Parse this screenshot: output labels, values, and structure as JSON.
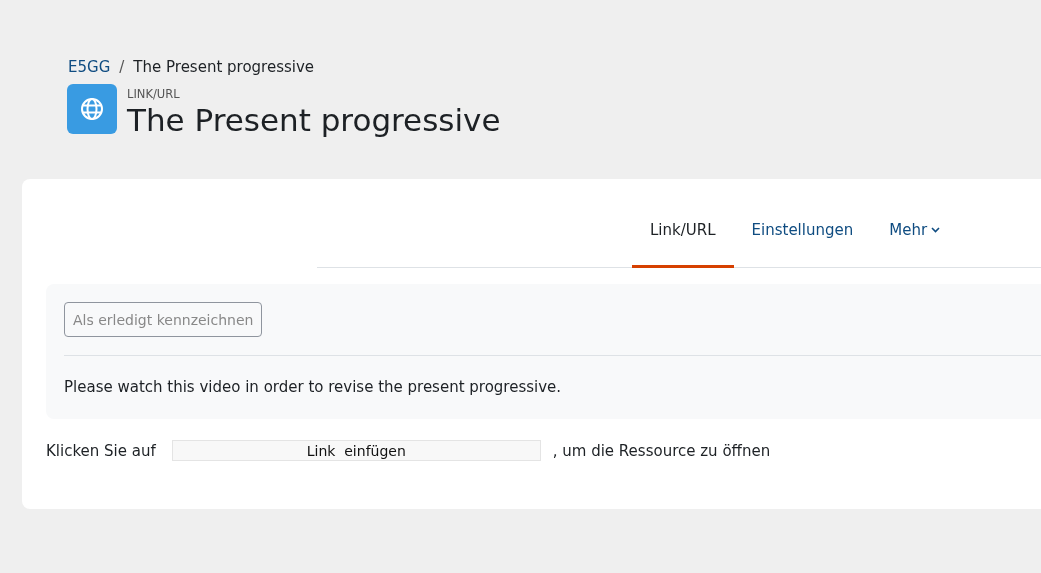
{
  "breadcrumb": [
    {
      "label": "E5GG",
      "kind": "link"
    },
    {
      "label": "/",
      "kind": "separator"
    },
    {
      "label": "The Present progressive",
      "kind": "current"
    }
  ],
  "header": {
    "type_label": "LINK/URL",
    "title": "The Present progressive"
  },
  "tabs": [
    {
      "label": "Link/URL",
      "selected": true,
      "dropdown": false
    },
    {
      "label": "Einstellungen",
      "selected": false,
      "dropdown": false
    },
    {
      "label": "Mehr",
      "selected": false,
      "dropdown": true
    }
  ],
  "completion_button": "Als erledigt kennzeichnen",
  "description": "Please watch this video in order to revise the present progressive.",
  "link_line": {
    "before": "Klicken Sie auf",
    "button": "Link  einfügen",
    "after": ", um die Ressource zu öffnen"
  }
}
